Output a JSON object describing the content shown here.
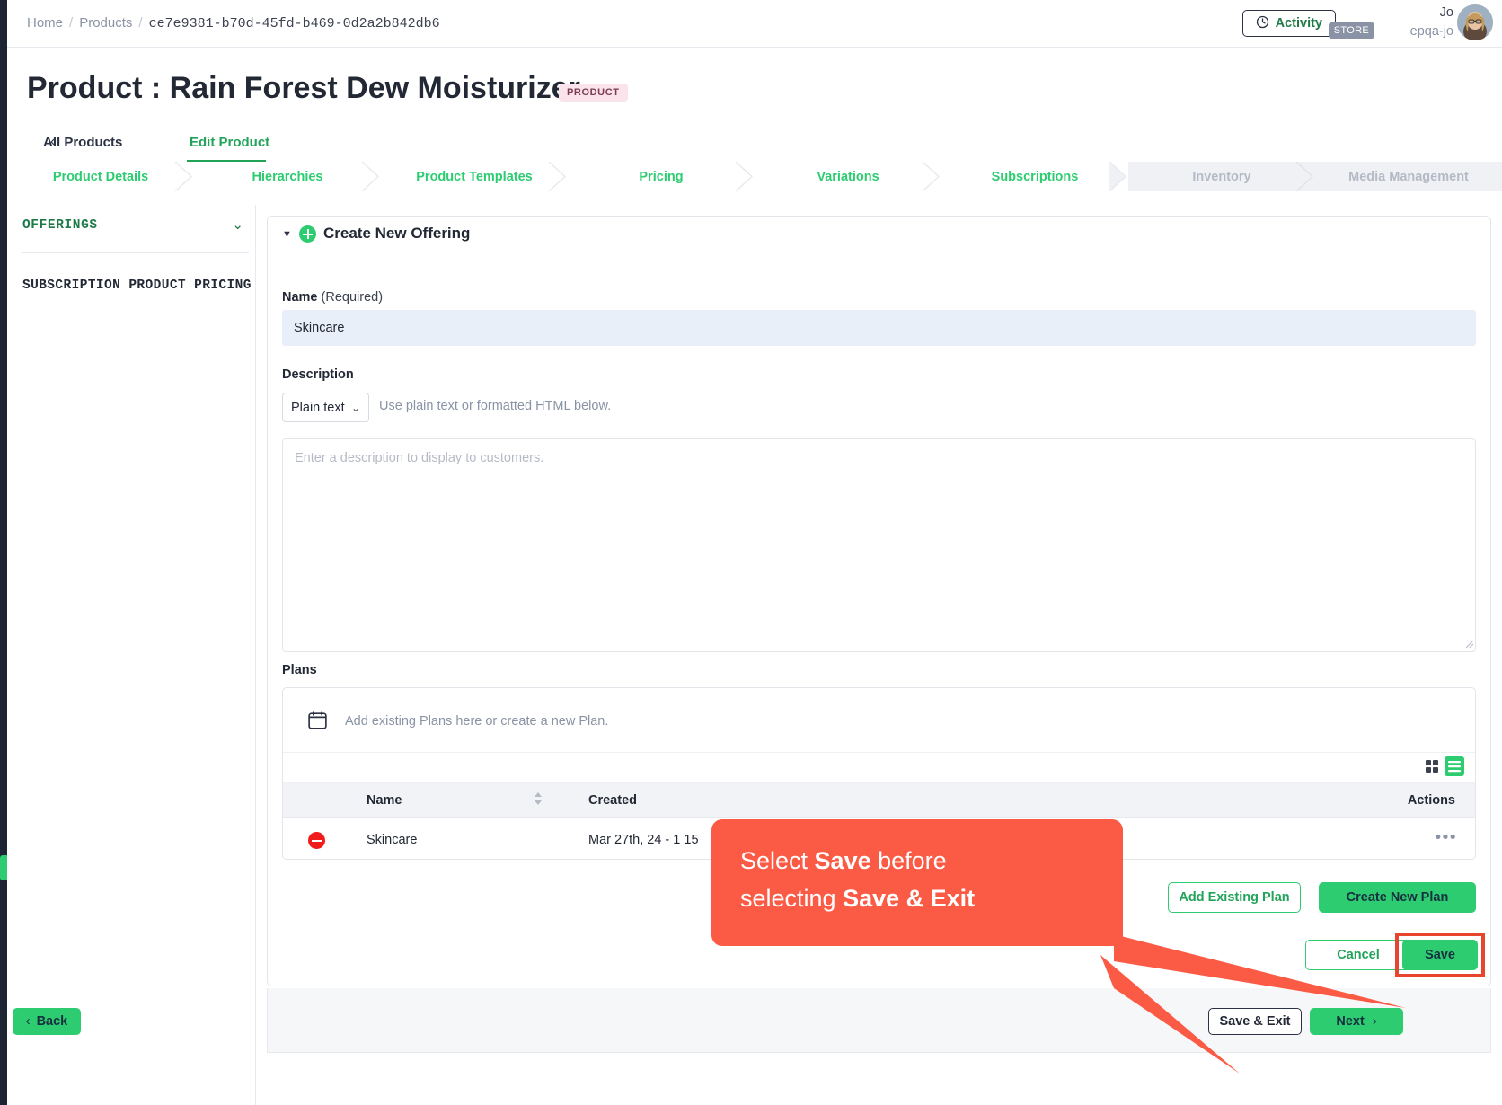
{
  "breadcrumb": {
    "home": "Home",
    "products": "Products",
    "id": "ce7e9381-b70d-45fd-b469-0d2a2b842db6",
    "separator": "/"
  },
  "topbar": {
    "activity_label": "Activity",
    "activity_icon": "clock-icon",
    "store_badge": "STORE",
    "user_name": "Jo",
    "user_handle": "epqa-jo"
  },
  "header": {
    "title": "Product : Rain Forest Dew Moisturizer",
    "badge": "PRODUCT"
  },
  "subtabs": [
    {
      "label": "All Products",
      "active": false
    },
    {
      "label": "Edit Product",
      "active": true
    }
  ],
  "steps": [
    {
      "label": "Product Details",
      "state": "enabled"
    },
    {
      "label": "Hierarchies",
      "state": "enabled"
    },
    {
      "label": "Product Templates",
      "state": "enabled"
    },
    {
      "label": "Pricing",
      "state": "enabled"
    },
    {
      "label": "Variations",
      "state": "enabled"
    },
    {
      "label": "Subscriptions",
      "state": "enabled"
    },
    {
      "label": "Inventory",
      "state": "disabled"
    },
    {
      "label": "Media Management",
      "state": "disabled"
    }
  ],
  "sidebar": {
    "offerings_label": "OFFERINGS",
    "offerings_chevron": "chevron-down-icon",
    "pricing_label": "SUBSCRIPTION PRODUCT PRICING"
  },
  "card": {
    "title": "Create New Offering",
    "caret": "caret-down-icon",
    "plus_icon": "circle-plus-icon",
    "name": {
      "label": "Name",
      "required_suffix": "(Required)",
      "value": "Skincare",
      "placeholder": ""
    },
    "description": {
      "label": "Description",
      "type_value": "Plain text",
      "hint": "Use plain text or formatted HTML below.",
      "placeholder": "Enter a description to display to customers.",
      "value": ""
    },
    "plans": {
      "label": "Plans",
      "drop_hint": "Add existing Plans here or create a new Plan.",
      "drop_icon": "calendar-icon",
      "view_grid_icon": "grid-view-icon",
      "view_list_icon": "list-view-icon",
      "columns": [
        "Name",
        "Created",
        "Actions"
      ],
      "sort_icon": "sort-arrows-icon",
      "rows": [
        {
          "remove_icon": "minus-circle-icon",
          "name": "Skincare",
          "created": "Mar 27th, 24 - 1        15",
          "actions_icon": "more-dots-icon"
        }
      ],
      "add_existing_label": "Add Existing Plan",
      "create_new_label": "Create New Plan"
    },
    "cancel_label": "Cancel",
    "save_label": "Save"
  },
  "footer": {
    "back_label": "Back",
    "save_exit_label": "Save & Exit",
    "next_label": "Next"
  },
  "callout": {
    "line1_pre": "Select ",
    "line1_bold": "Save",
    "line1_post": " before",
    "line2_pre": "selecting ",
    "line2_bold": "Save & Exit",
    "color": "#fb5a45"
  },
  "colors": {
    "accent_green": "#2ecc71",
    "green_text": "#23a35a",
    "callout_red": "#fb5a45",
    "highlight_red": "#e8452f",
    "badge_pink": "#fbe3ec",
    "input_focus_blue": "#e9eff9"
  }
}
